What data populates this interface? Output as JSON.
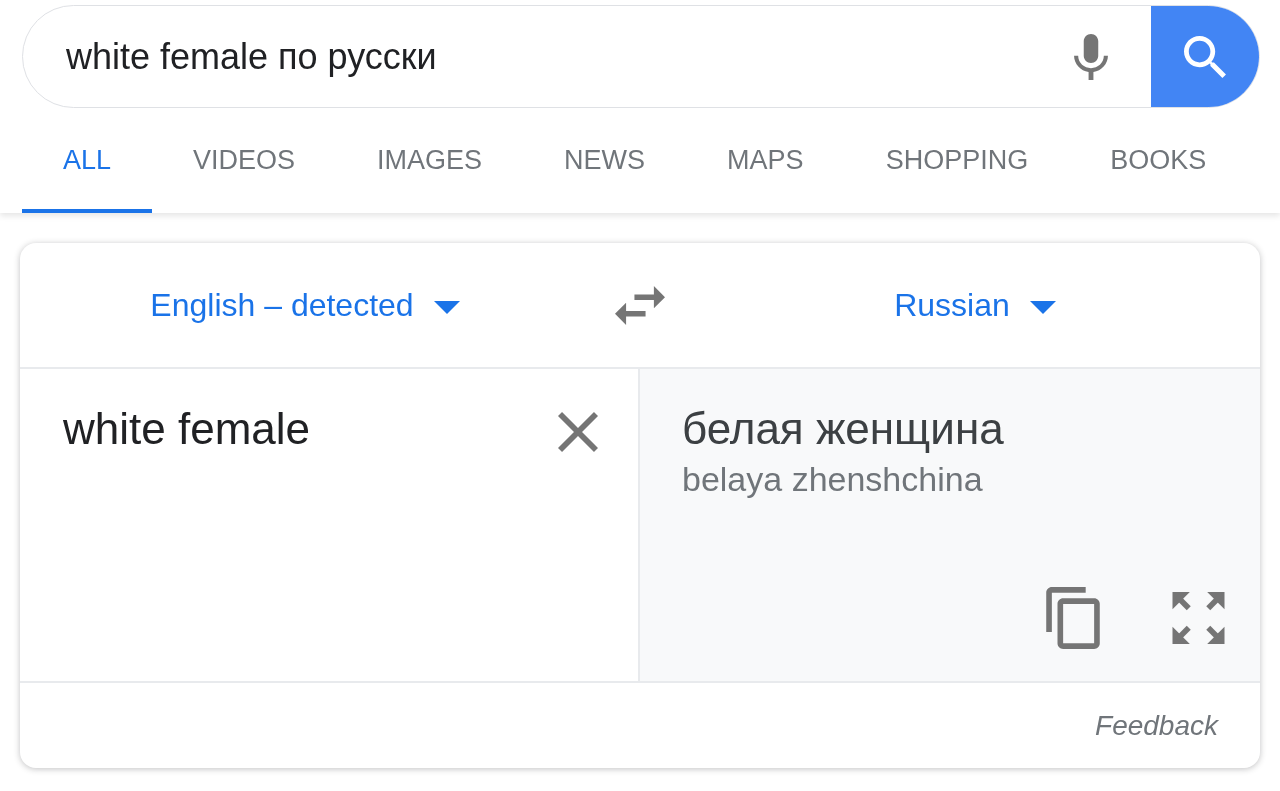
{
  "search": {
    "value": "white female по русски"
  },
  "tabs": [
    {
      "label": "ALL",
      "selected": true
    },
    {
      "label": "VIDEOS",
      "selected": false
    },
    {
      "label": "IMAGES",
      "selected": false
    },
    {
      "label": "NEWS",
      "selected": false
    },
    {
      "label": "MAPS",
      "selected": false
    },
    {
      "label": "SHOPPING",
      "selected": false
    },
    {
      "label": "BOOKS",
      "selected": false
    }
  ],
  "translator": {
    "source_language": "English – detected",
    "target_language": "Russian",
    "source_text": "white female",
    "translation": "белая женщина",
    "transliteration": "belaya zhenshchina",
    "feedback": "Feedback"
  }
}
